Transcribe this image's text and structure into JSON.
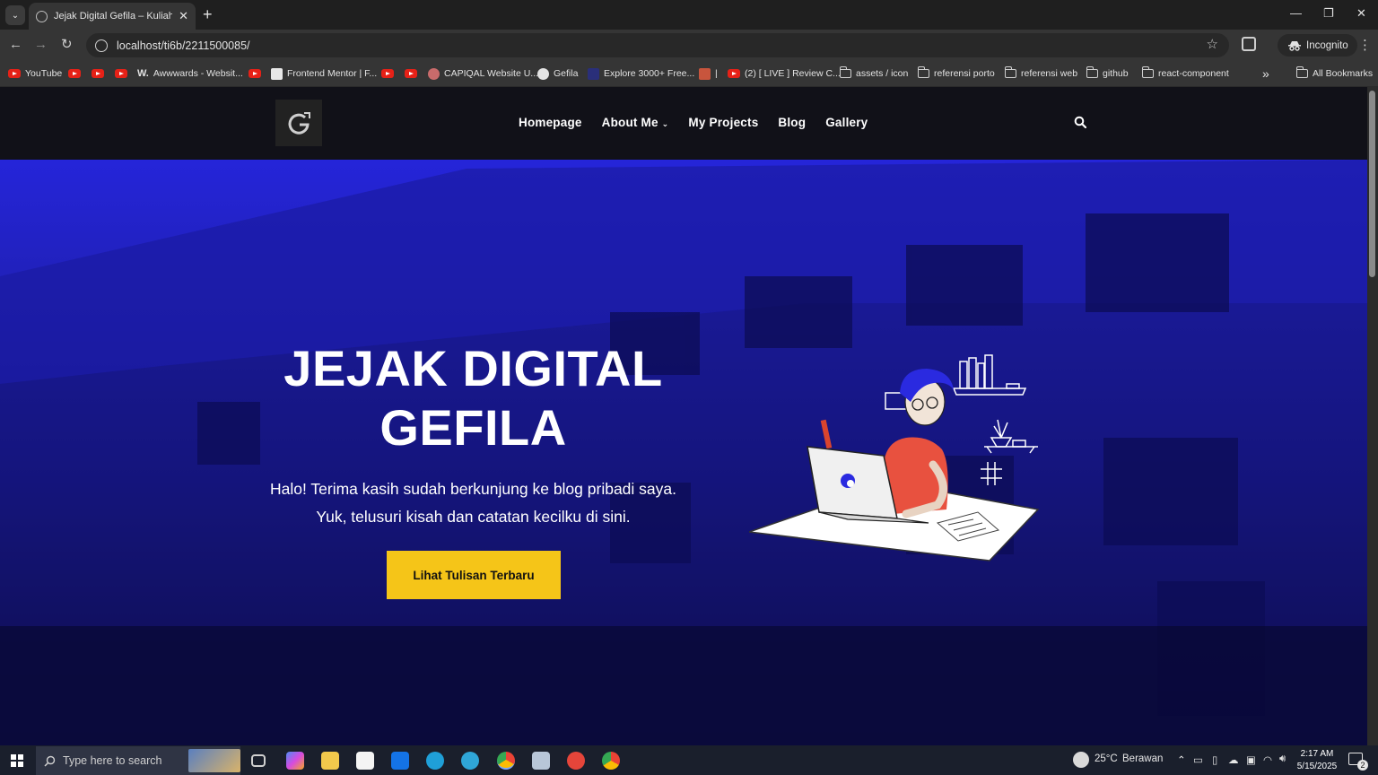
{
  "browser": {
    "tab_title": "Jejak Digital Gefila – Kuliah, kar",
    "url": "localhost/ti6b/2211500085/",
    "incognito_label": "Incognito",
    "new_tab_symbol": "+",
    "close_tab_symbol": "✕",
    "window_controls": {
      "minimize": "—",
      "maximize": "❐",
      "close": "✕"
    },
    "bookmarks": [
      {
        "label": "YouTube",
        "icon": "youtube-icon"
      },
      {
        "label": "",
        "icon": "youtube-icon"
      },
      {
        "label": "",
        "icon": "youtube-icon"
      },
      {
        "label": "",
        "icon": "youtube-icon"
      },
      {
        "label": "Awwwards - Websit...",
        "icon": "awwwards-icon"
      },
      {
        "label": "",
        "icon": "youtube-icon"
      },
      {
        "label": "Frontend Mentor | F...",
        "icon": "frontendmentor-icon"
      },
      {
        "label": "",
        "icon": "youtube-icon"
      },
      {
        "label": "",
        "icon": "youtube-icon"
      },
      {
        "label": "CAPIQAL Website U...",
        "icon": "capiqal-icon"
      },
      {
        "label": "Gefila",
        "icon": "github-icon"
      },
      {
        "label": "Explore 3000+ Free...",
        "icon": "ui-icon"
      },
      {
        "label": "|",
        "icon": "app-icon"
      },
      {
        "label": "(2) [ LIVE ] Review C...",
        "icon": "youtube-icon"
      },
      {
        "label": "assets / icon",
        "icon": "folder-icon"
      },
      {
        "label": "referensi porto",
        "icon": "folder-icon"
      },
      {
        "label": "referensi web",
        "icon": "folder-icon"
      },
      {
        "label": "github",
        "icon": "folder-icon"
      },
      {
        "label": "react-component",
        "icon": "folder-icon"
      }
    ],
    "overflow_symbol": "»",
    "all_bookmarks_label": "All Bookmarks"
  },
  "site": {
    "nav": [
      {
        "label": "Homepage"
      },
      {
        "label": "About Me",
        "has_dropdown": true
      },
      {
        "label": "My Projects"
      },
      {
        "label": "Blog"
      },
      {
        "label": "Gallery"
      }
    ],
    "hero": {
      "title_line1": "JEJAK DIGITAL",
      "title_line2": "GEFILA",
      "subtitle": "Halo! Terima kasih sudah berkunjung ke blog pribadi saya. Yuk, telusuri kisah dan catatan kecilku di sini.",
      "cta_label": "Lihat Tulisan Terbaru"
    },
    "colors": {
      "header_bg": "#111118",
      "hero_overlay": "#2323c8",
      "cta_bg": "#f5c518",
      "illustration_shirt": "#e8513f",
      "illustration_hair": "#2a2ae0"
    }
  },
  "taskbar": {
    "search_placeholder": "Type here to search",
    "weather_temp": "25°C",
    "weather_desc": "Berawan",
    "time": "2:17 AM",
    "date": "5/15/2025",
    "notification_count": "2"
  }
}
